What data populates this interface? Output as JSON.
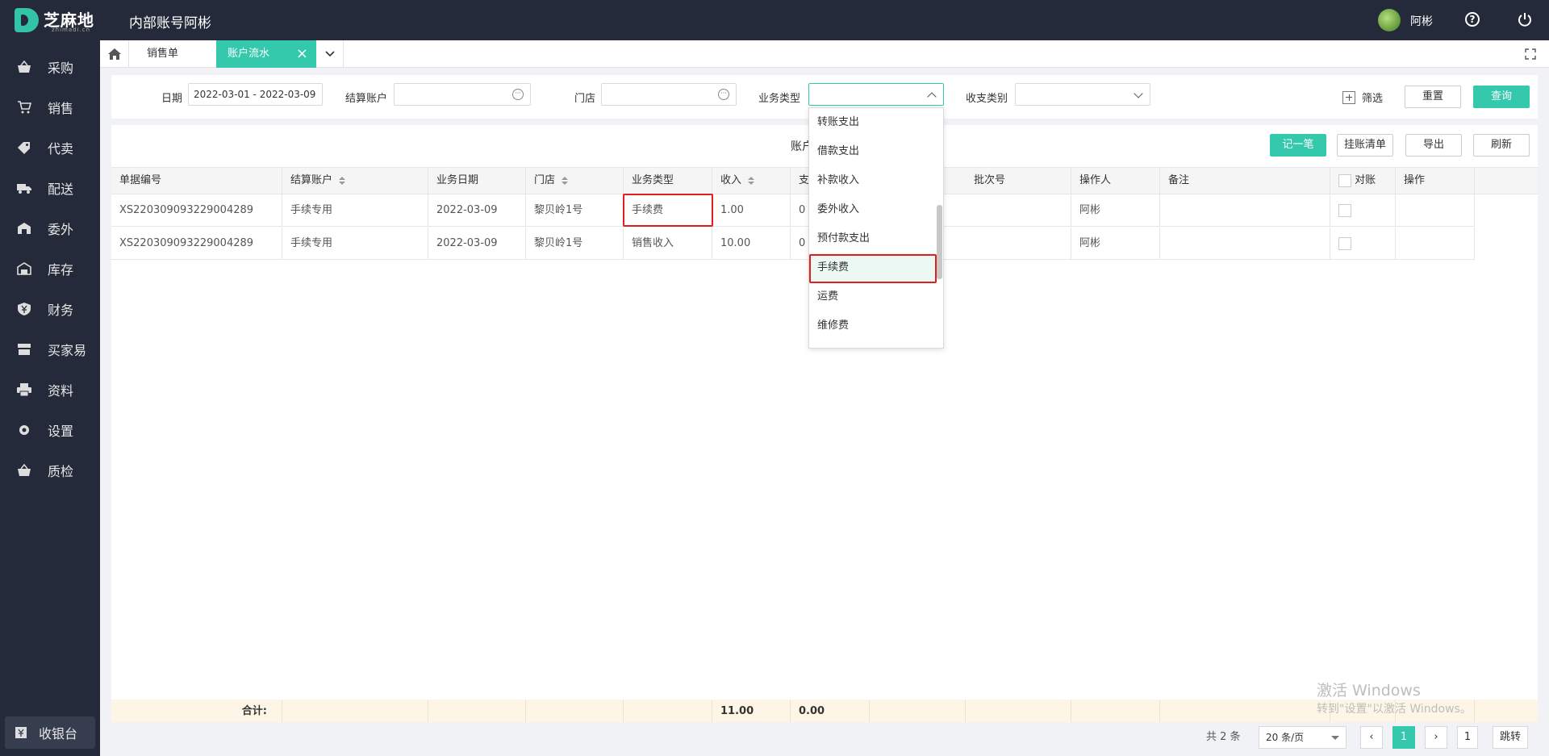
{
  "header": {
    "logo_text": "芝麻地",
    "logo_sub": "zhimadi.cn",
    "app_title": "内部账号阿彬",
    "username": "阿彬"
  },
  "sidebar": {
    "items": [
      {
        "label": "采购",
        "icon": "basket-icon"
      },
      {
        "label": "销售",
        "icon": "cart-icon"
      },
      {
        "label": "代卖",
        "icon": "tag-icon"
      },
      {
        "label": "配送",
        "icon": "truck-icon"
      },
      {
        "label": "委外",
        "icon": "building-icon"
      },
      {
        "label": "库存",
        "icon": "warehouse-icon"
      },
      {
        "label": "财务",
        "icon": "yen-shield-icon"
      },
      {
        "label": "买家易",
        "icon": "store-icon"
      },
      {
        "label": "资料",
        "icon": "printer-icon"
      },
      {
        "label": "设置",
        "icon": "gear-icon"
      },
      {
        "label": "质检",
        "icon": "basket-check-icon"
      }
    ],
    "cashier": "收银台"
  },
  "tabs": {
    "items": [
      "销售单",
      "账户流水"
    ],
    "active": "账户流水"
  },
  "filters": {
    "date_label": "日期",
    "date_value": "2022-03-01 - 2022-03-09",
    "account_label": "结算账户",
    "store_label": "门店",
    "biz_type_label": "业务类型",
    "pay_type_label": "收支类别",
    "filter_label": "筛选",
    "reset": "重置",
    "query": "查询"
  },
  "toolbar": {
    "title": "账户",
    "record": "记一笔",
    "hang_list": "挂账清单",
    "export": "导出",
    "refresh": "刷新"
  },
  "table": {
    "headers": [
      "单据编号",
      "结算账户",
      "业务日期",
      "门店",
      "业务类型",
      "收入",
      "支",
      "批次号",
      "操作人",
      "备注",
      "对账",
      "操作"
    ],
    "rows": [
      [
        "XS220309093229004289",
        "手续专用",
        "2022-03-09",
        "黎贝岭1号",
        "手续费",
        "1.00",
        "0",
        "",
        "阿彬",
        ""
      ],
      [
        "XS220309093229004289",
        "手续专用",
        "2022-03-09",
        "黎贝岭1号",
        "销售收入",
        "10.00",
        "0",
        "",
        "阿彬",
        ""
      ]
    ],
    "sum_label": "合计:",
    "sum_income": "11.00",
    "sum_expense": "0.00"
  },
  "dropdown": {
    "options": [
      "转账支出",
      "借款支出",
      "补款收入",
      "委外收入",
      "预付款支出",
      "手续费",
      "运费",
      "维修费"
    ],
    "highlighted": "手续费"
  },
  "pagination": {
    "total": "共 2 条",
    "page_size": "20 条/页",
    "current": "1",
    "jump_value": "1",
    "jump_label": "跳转"
  },
  "watermark": {
    "line1": "激活 Windows",
    "line2": "转到\"设置\"以激活 Windows。"
  },
  "colors": {
    "accent": "#34c9ac",
    "sidebar_bg": "#242a3a",
    "highlight_border": "#e02020"
  }
}
